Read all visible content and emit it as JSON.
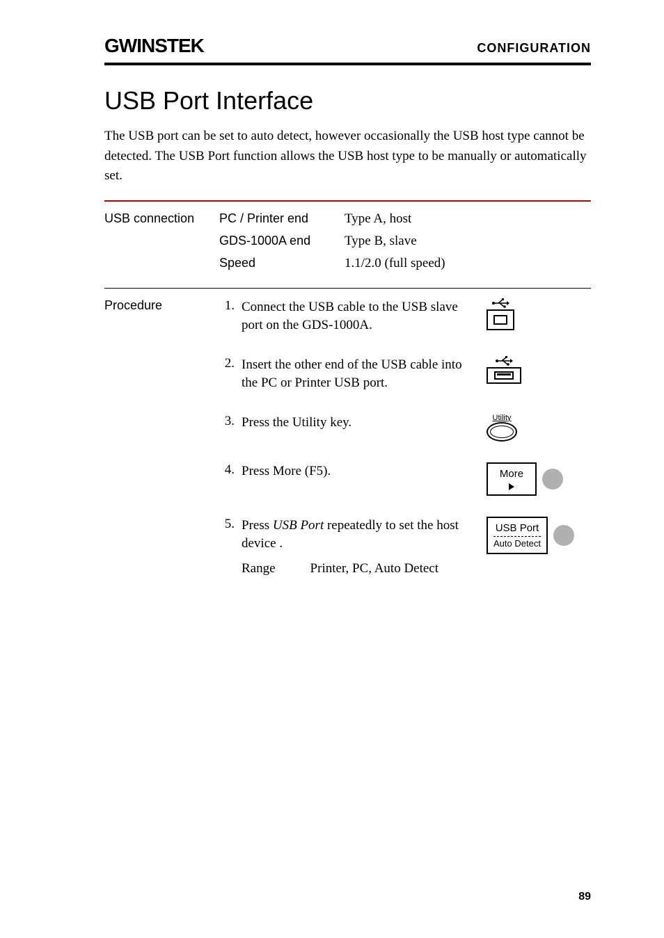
{
  "header": {
    "brand": "GWINSTEK",
    "section": "CONFIGURATION"
  },
  "title": "USB Port Interface",
  "intro": "The USB port can be set to auto detect, however occasionally the USB host type cannot be detected. The USB Port function allows the USB host type to be manually or automatically set.",
  "usb_connection": {
    "label": "USB connection",
    "rows": [
      {
        "key": "PC / Printer end",
        "val": "Type A, host"
      },
      {
        "key": "GDS-1000A end",
        "val": "Type B, slave"
      },
      {
        "key": "Speed",
        "val": "1.1/2.0 (full speed)"
      }
    ]
  },
  "procedure": {
    "label": "Procedure",
    "steps": [
      {
        "num": "1.",
        "text": "Connect the USB cable to the USB slave port on the GDS-1000A."
      },
      {
        "num": "2.",
        "text": "Insert the other end of the USB cable into the PC or Printer USB port."
      },
      {
        "num": "3.",
        "text": "Press the Utility key."
      },
      {
        "num": "4.",
        "text": "Press More (F5)."
      },
      {
        "num": "5.",
        "text_before": "Press ",
        "text_italic": "USB Port",
        "text_after": " repeatedly to set the host device ."
      }
    ],
    "range": {
      "label": "Range",
      "value": "Printer, PC, Auto Detect"
    }
  },
  "buttons": {
    "utility": "Utility",
    "more": "More",
    "usb_port": "USB Port",
    "auto_detect": "Auto Detect"
  },
  "page_number": "89"
}
